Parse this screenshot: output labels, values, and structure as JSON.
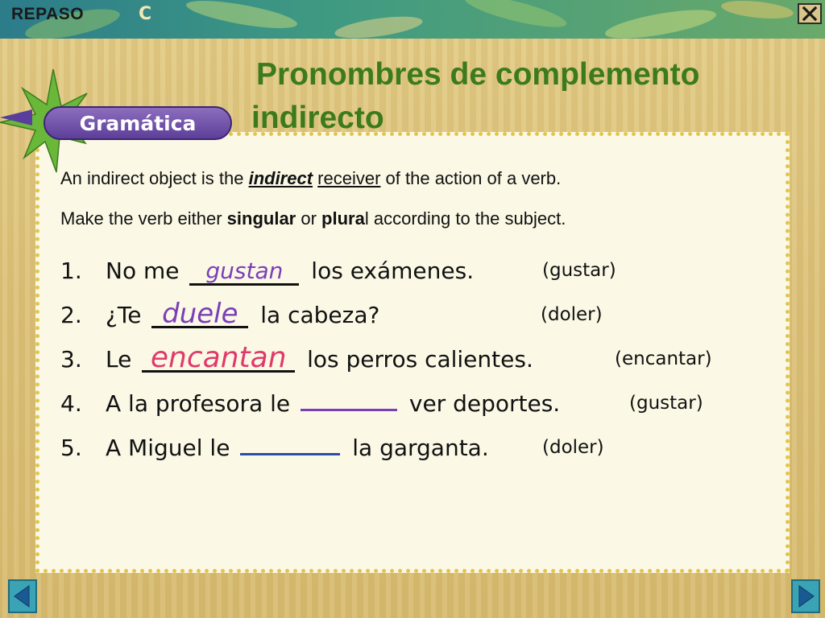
{
  "banner": {
    "label": "REPASO",
    "letter": "C"
  },
  "title": {
    "line1": "Pronombres de complemento",
    "line2": "indirecto"
  },
  "badge": {
    "label": "Gramática"
  },
  "intro": {
    "line1_pre": "An indirect object is the ",
    "line1_bold": "indirect",
    "line1_mid": "receiver",
    "line1_post": " of the action of a verb.",
    "line2_pre": "Make the verb either ",
    "line2_b1": "singular",
    "line2_mid": " or ",
    "line2_b2": "plura",
    "line2_post": "l according to the subject."
  },
  "exercises": [
    {
      "num": "1.",
      "pre": "No me ",
      "answer": "gustan",
      "post": " los exámenes.",
      "hint": "(gustar)"
    },
    {
      "num": "2.",
      "pre": "¿Te ",
      "answer": "duele",
      "post": " la cabeza?",
      "hint": "(doler)"
    },
    {
      "num": "3.",
      "pre": "Le ",
      "answer": "encantan",
      "post": " los perros calientes.",
      "hint": "(encantar)"
    },
    {
      "num": "4.",
      "pre": "A la profesora le ",
      "answer": "",
      "post": " ver deportes.",
      "hint": "(gustar)"
    },
    {
      "num": "5.",
      "pre": "A Miguel le ",
      "answer": "",
      "post": " la garganta.",
      "hint": "(doler)"
    }
  ],
  "icons": {
    "close": "close-icon",
    "prev": "arrow-left-icon",
    "next": "arrow-right-icon"
  },
  "colors": {
    "title": "#3c7a1e",
    "badge": "#6a4aa8",
    "answer_purple": "#7a3fb7",
    "answer_pink": "#e03a6a"
  }
}
